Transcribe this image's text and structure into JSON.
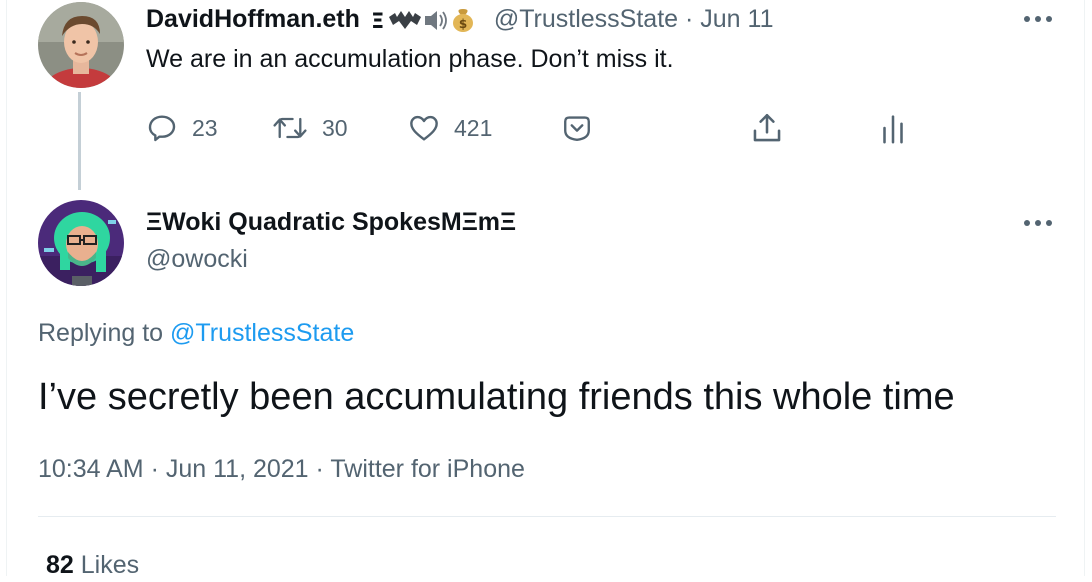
{
  "tweet1": {
    "display_name": "DavidHoffman.eth",
    "name_badges": "Ξ🦇🔊💰",
    "handle": "@TrustlessState",
    "separator": "·",
    "date": "Jun 11",
    "text": "We are in an accumulation phase. Don’t miss it.",
    "actions": {
      "replies": "23",
      "retweets": "30",
      "likes": "421"
    }
  },
  "tweet2": {
    "display_name": "ΞWoki Quadratic SpokesMΞmΞ",
    "handle": "@owocki",
    "replying_prefix": "Replying to",
    "replying_handle": "@TrustlessState",
    "text": "I’ve secretly been accumulating friends this whole time",
    "time": "10:34 AM",
    "meta_sep1": "·",
    "date": "Jun 11, 2021",
    "meta_sep2": "·",
    "source": "Twitter for iPhone",
    "likes_count": "82",
    "likes_label": "Likes"
  },
  "colors": {
    "text": "#0f1419",
    "muted": "#536471",
    "link": "#1d9bf0",
    "thread_line": "#c4cfd6",
    "divider": "#e6ecf0"
  },
  "icons": [
    "reply-icon",
    "retweet-icon",
    "like-icon",
    "tip-icon",
    "share-icon",
    "analytics-icon",
    "more-icon"
  ]
}
